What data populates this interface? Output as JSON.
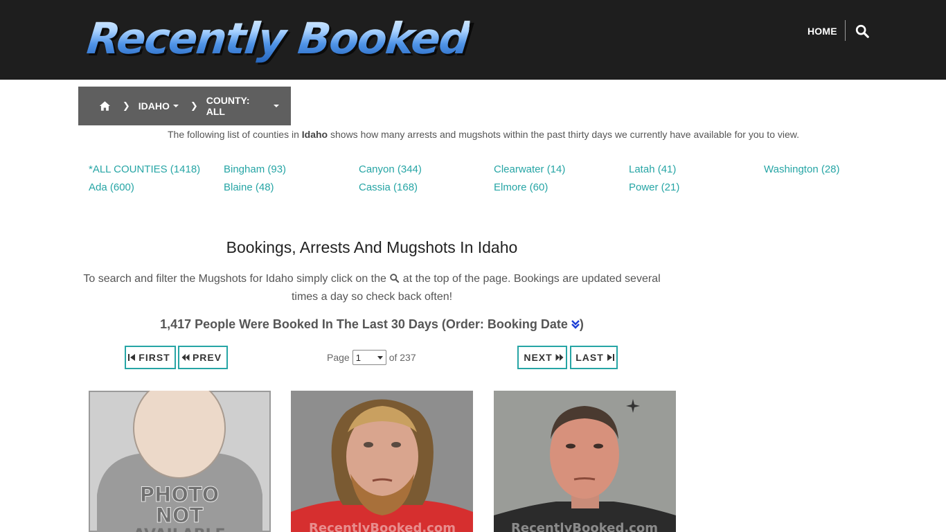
{
  "header": {
    "logo_text": "Recently Booked",
    "nav_home": "HOME",
    "search_icon": "search-icon"
  },
  "breadcrumb": {
    "home_icon": "home-icon",
    "state": "IDAHO",
    "county": "COUNTY: ALL"
  },
  "intro": {
    "before": "The following list of counties in ",
    "state": "Idaho",
    "after": " shows how many arrests and mugshots within the past thirty days we currently have available for you to view."
  },
  "counties": [
    "*ALL COUNTIES (1418)",
    "Ada (600)",
    "Bingham (93)",
    "Blaine (48)",
    "Canyon (344)",
    "Cassia (168)",
    "Clearwater (14)",
    "Elmore (60)",
    "Latah (41)",
    "Power (21)",
    "Washington (28)"
  ],
  "main": {
    "title": "Bookings, Arrests And Mugshots In Idaho",
    "desc_before": "To search and filter the Mugshots for Idaho simply click on the ",
    "desc_after": " at the top of the page. Bookings are updated several times a day so check back often!",
    "count_text": "1,417 People Were Booked In The Last 30 Days (Order: Booking Date ",
    "count_close": ")"
  },
  "pager": {
    "first": "FIRST",
    "prev": "PREV",
    "next": "NEXT",
    "last": "LAST",
    "page_label": "Page",
    "page_value": "1",
    "of_label": "of 237"
  },
  "mugshots": {
    "placeholder_line1": "PHOTO",
    "placeholder_line2": "NOT",
    "placeholder_line3": "AVAILABLE",
    "watermark": "RecentlyBooked.com"
  },
  "colors": {
    "accent": "#26a5a5",
    "header_bg": "#1e1e1e",
    "breadcrumb_bg": "#5f5f5f",
    "order_icon": "#1d3fd6"
  }
}
